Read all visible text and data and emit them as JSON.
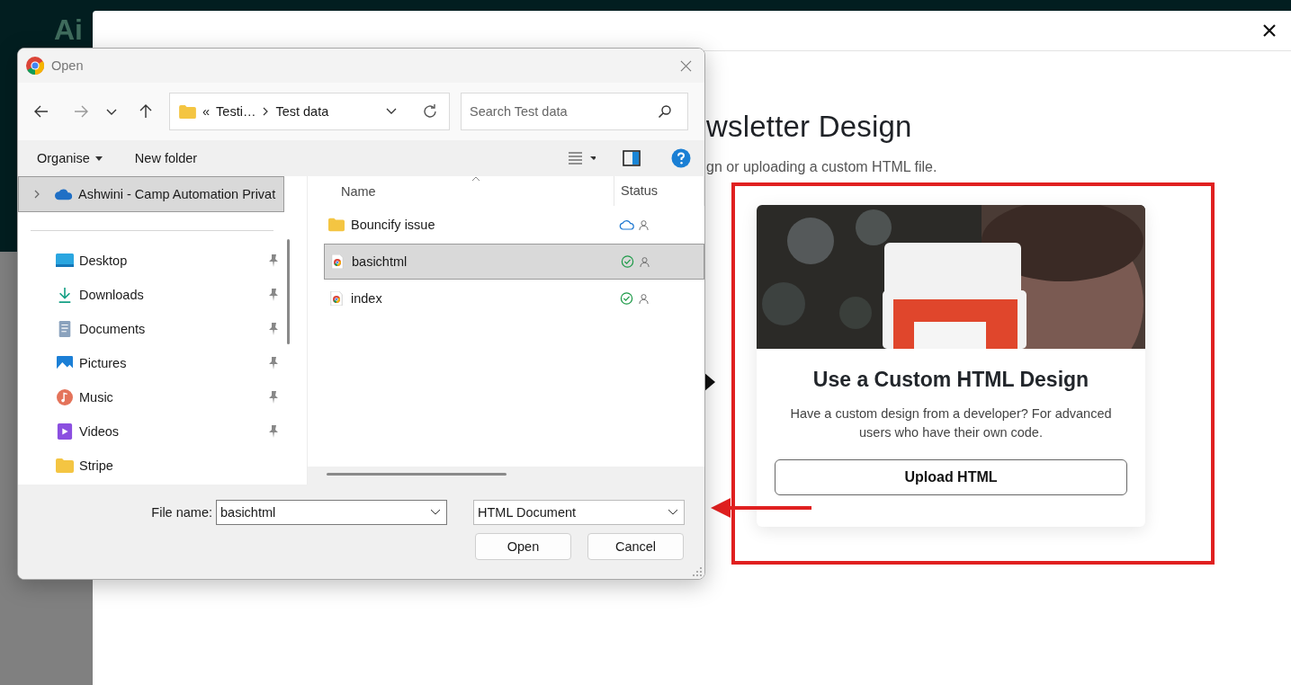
{
  "backdrop": {
    "logo": "Ai"
  },
  "modal": {
    "heading": "wsletter Design",
    "subtitle": "gn or uploading a custom HTML file.",
    "card": {
      "title": "Use a Custom HTML Design",
      "description": "Have a custom design from a developer? For advanced users who have their own code.",
      "button": "Upload HTML"
    }
  },
  "dialog": {
    "title": "Open",
    "address": {
      "prefix": "«",
      "segments": [
        "Testi…",
        "Test data"
      ]
    },
    "search": {
      "placeholder": "Search Test data"
    },
    "toolbar": {
      "organise": "Organise",
      "new_folder": "New folder"
    },
    "nav": [
      {
        "label": "Ashwini - Camp Automation Privat",
        "kind": "cloud",
        "selected": true,
        "pinned": false
      },
      {
        "label": "Desktop",
        "kind": "desktop",
        "selected": false,
        "pinned": true
      },
      {
        "label": "Downloads",
        "kind": "downloads",
        "selected": false,
        "pinned": true
      },
      {
        "label": "Documents",
        "kind": "documents",
        "selected": false,
        "pinned": true
      },
      {
        "label": "Pictures",
        "kind": "pictures",
        "selected": false,
        "pinned": true
      },
      {
        "label": "Music",
        "kind": "music",
        "selected": false,
        "pinned": true
      },
      {
        "label": "Videos",
        "kind": "videos",
        "selected": false,
        "pinned": true
      },
      {
        "label": "Stripe",
        "kind": "folder",
        "selected": false,
        "pinned": false
      }
    ],
    "columns": [
      "Name",
      "Status"
    ],
    "files": [
      {
        "name": "Bouncify issue",
        "kind": "folder",
        "status": {
          "kind": "cloud"
        },
        "selected": false
      },
      {
        "name": "basichtml",
        "kind": "html",
        "status": {
          "kind": "synced"
        },
        "selected": true
      },
      {
        "name": "index",
        "kind": "html",
        "status": {
          "kind": "synced"
        },
        "selected": false
      }
    ],
    "file_name": {
      "label": "File name:",
      "value": "basichtml"
    },
    "file_type": "HTML Document",
    "buttons": [
      "Open",
      "Cancel"
    ]
  }
}
